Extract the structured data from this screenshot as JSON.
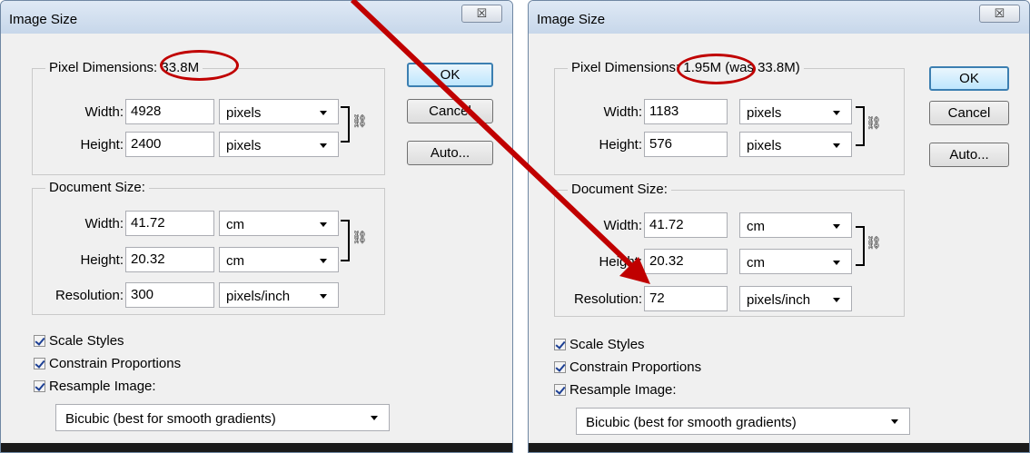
{
  "colors": {
    "annotation": "#c00000",
    "default_button_border": "#3c7fb1",
    "checkbox_tick": "#1c3f94"
  },
  "dialogs": [
    {
      "title": "Image Size",
      "close_glyph": "☒",
      "pixel_dimensions": {
        "label": "Pixel Dimensions:",
        "value": "33.8M",
        "width_label": "Width:",
        "width_value": "4928",
        "width_unit": "pixels",
        "height_label": "Height:",
        "height_value": "2400",
        "height_unit": "pixels"
      },
      "document_size": {
        "label": "Document Size:",
        "width_label": "Width:",
        "width_value": "41.72",
        "width_unit": "cm",
        "height_label": "Height:",
        "height_value": "20.32",
        "height_unit": "cm",
        "resolution_label": "Resolution:",
        "resolution_value": "300",
        "resolution_unit": "pixels/inch"
      },
      "checkboxes": [
        "Scale Styles",
        "Constrain Proportions",
        "Resample Image:"
      ],
      "resample_method": "Bicubic (best for smooth gradients)",
      "buttons": {
        "ok": "OK",
        "cancel": "Cancel",
        "auto": "Auto..."
      }
    },
    {
      "title": "Image Size",
      "close_glyph": "☒",
      "pixel_dimensions": {
        "label": "Pixel Dimensions:",
        "value": "1.95M (was 33.8M)",
        "width_label": "Width:",
        "width_value": "1183",
        "width_unit": "pixels",
        "height_label": "Height:",
        "height_value": "576",
        "height_unit": "pixels"
      },
      "document_size": {
        "label": "Document Size:",
        "width_label": "Width:",
        "width_value": "41.72",
        "width_unit": "cm",
        "height_label": "Height:",
        "height_value": "20.32",
        "height_unit": "cm",
        "resolution_label": "Resolution:",
        "resolution_value": "72",
        "resolution_unit": "pixels/inch"
      },
      "checkboxes": [
        "Scale Styles",
        "Constrain Proportions",
        "Resample Image:"
      ],
      "resample_method": "Bicubic (best for smooth gradients)",
      "buttons": {
        "ok": "OK",
        "cancel": "Cancel",
        "auto": "Auto..."
      }
    }
  ]
}
